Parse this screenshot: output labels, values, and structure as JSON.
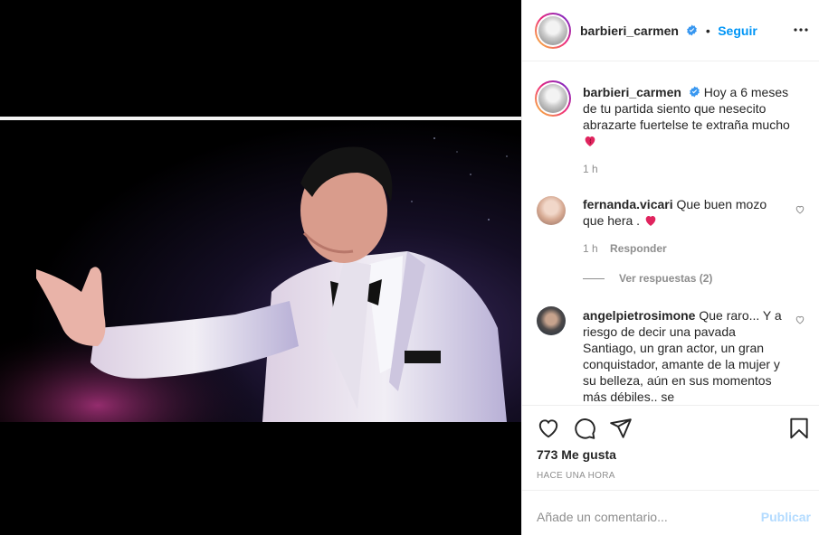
{
  "post": {
    "username": "barbieri_carmen",
    "follow_label": "Seguir",
    "dot": "•",
    "caption": "Hoy a 6 meses de tu partida siento que nesecito abrazarte fuertelse te extraña mucho",
    "caption_time": "1 h"
  },
  "comments": [
    {
      "username": "fernanda.vicari",
      "text": "Que buen mozo que hera .",
      "time": "1 h",
      "reply_label": "Responder",
      "view_replies": "Ver respuestas (2)"
    },
    {
      "username": "angelpietrosimone",
      "text": "Que raro... Y a riesgo de decir una pavada Santiago, un gran actor, un gran conquistador, amante de la mujer y su belleza, aún en sus momentos más débiles.. se"
    }
  ],
  "actions": {
    "likes": "773 Me gusta",
    "time_ago": "HACE UNA HORA"
  },
  "composer": {
    "placeholder": "Añade un comentario...",
    "publish_label": "Publicar"
  },
  "colors": {
    "accent": "#0095f6",
    "verified": "#3897f0",
    "heart": "#e0245e",
    "publish_disabled": "#b3dbff"
  },
  "icons": [
    "verified-badge-icon",
    "more-options-icon",
    "heart-emoji-icon",
    "like-heart-icon",
    "comment-icon",
    "share-icon",
    "bookmark-icon"
  ]
}
